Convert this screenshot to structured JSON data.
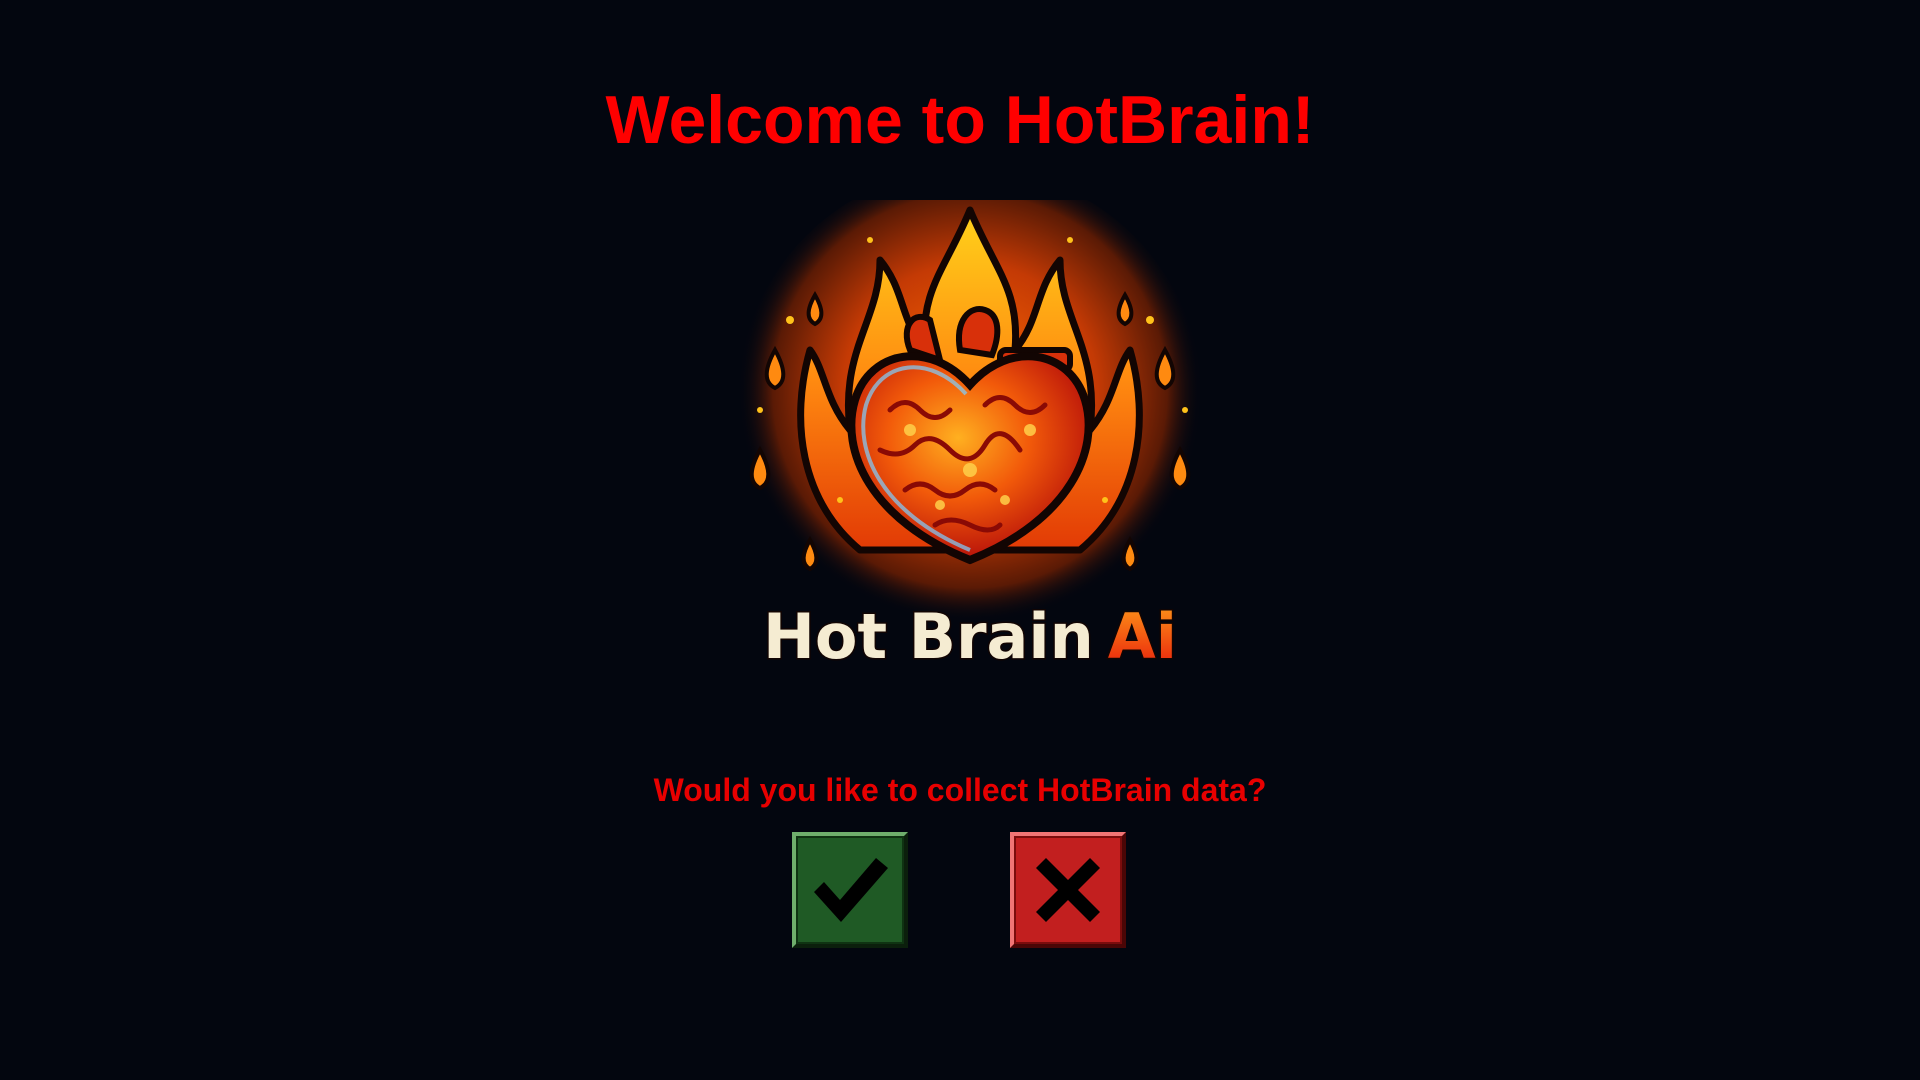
{
  "header": {
    "title": "Welcome to HotBrain!"
  },
  "logo": {
    "text_main": "Hot Brain",
    "text_accent": "Ai"
  },
  "prompt": {
    "question": "Would you like to collect HotBrain data?"
  },
  "buttons": {
    "accept_icon": "checkmark-icon",
    "decline_icon": "x-icon"
  },
  "colors": {
    "background": "#03060f",
    "title_red": "#ff0000",
    "accept_green": "#1f5a25",
    "decline_red": "#c21f1f"
  }
}
